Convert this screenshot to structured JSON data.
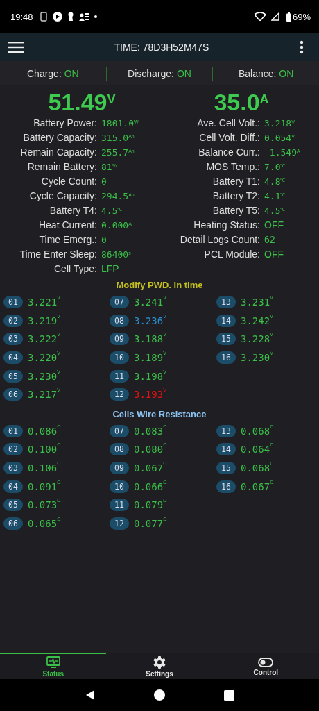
{
  "status_bar": {
    "time": "19:48",
    "battery": "69%"
  },
  "app_bar": {
    "title": "TIME: 78D3H52M47S"
  },
  "switches": [
    {
      "label": "Charge:",
      "value": "ON"
    },
    {
      "label": "Discharge:",
      "value": "ON"
    },
    {
      "label": "Balance:",
      "value": "ON"
    }
  ],
  "headline": [
    {
      "value": "51.49",
      "unit": "V"
    },
    {
      "value": "35.0",
      "unit": "A"
    }
  ],
  "stats_left": [
    {
      "label": "Battery Power:",
      "value": "1801.0",
      "unit": "W",
      "kind": "mono"
    },
    {
      "label": "Battery Capacity:",
      "value": "315.0",
      "unit": "Ah",
      "kind": "mono"
    },
    {
      "label": "Remain Capacity:",
      "value": "255.7",
      "unit": "Ah",
      "kind": "mono"
    },
    {
      "label": "Remain Battery:",
      "value": "81",
      "unit": "%",
      "kind": "mono"
    },
    {
      "label": "Cycle Count:",
      "value": "0",
      "kind": "mono"
    },
    {
      "label": "Cycle Capacity:",
      "value": "294.5",
      "unit": "Ah",
      "kind": "mono"
    },
    {
      "label": "Battery T4:",
      "value": "4.5",
      "unit": "℃",
      "kind": "mono"
    },
    {
      "label": "Heat Current:",
      "value": "0.000",
      "unit": "A",
      "kind": "mono"
    },
    {
      "label": "Time Emerg.:",
      "value": "0",
      "kind": "mono"
    },
    {
      "label": "Time Enter Sleep:",
      "value": "86400",
      "unit": "s",
      "kind": "mono"
    },
    {
      "label": "Cell Type:",
      "value": "LFP",
      "kind": "text"
    }
  ],
  "stats_right": [
    {
      "label": "Ave. Cell Volt.:",
      "value": "3.218",
      "unit": "V",
      "kind": "mono"
    },
    {
      "label": "Cell Volt. Diff.:",
      "value": "0.054",
      "unit": "V",
      "kind": "mono"
    },
    {
      "label": "Balance Curr.:",
      "value": "-1.549",
      "unit": "A",
      "kind": "mono"
    },
    {
      "label": "MOS Temp.:",
      "value": "7.0",
      "unit": "℃",
      "kind": "mono"
    },
    {
      "label": "Battery T1:",
      "value": "4.8",
      "unit": "℃",
      "kind": "mono"
    },
    {
      "label": "Battery T2:",
      "value": "4.1",
      "unit": "℃",
      "kind": "mono"
    },
    {
      "label": "Battery T5:",
      "value": "4.5",
      "unit": "℃",
      "kind": "mono"
    },
    {
      "label": "Heating Status:",
      "value": "OFF",
      "kind": "text"
    },
    {
      "label": "Detail Logs Count:",
      "value": "62",
      "kind": "text"
    },
    {
      "label": "PCL Module:",
      "value": "OFF",
      "kind": "text"
    }
  ],
  "cell_voltages": {
    "title": "Modify PWD. in time",
    "cells": [
      {
        "index": "01",
        "value": "3.221",
        "unit": "V",
        "color": "#3bbf48"
      },
      {
        "index": "02",
        "value": "3.219",
        "unit": "V",
        "color": "#3bbf48"
      },
      {
        "index": "03",
        "value": "3.222",
        "unit": "V",
        "color": "#3bbf48"
      },
      {
        "index": "04",
        "value": "3.220",
        "unit": "V",
        "color": "#3bbf48"
      },
      {
        "index": "05",
        "value": "3.230",
        "unit": "V",
        "color": "#3bbf48"
      },
      {
        "index": "06",
        "value": "3.217",
        "unit": "V",
        "color": "#3bbf48"
      },
      {
        "index": "07",
        "value": "3.241",
        "unit": "V",
        "color": "#3bbf48"
      },
      {
        "index": "08",
        "value": "3.236",
        "unit": "V",
        "color": "#2a8fd0"
      },
      {
        "index": "09",
        "value": "3.188",
        "unit": "V",
        "color": "#3bbf48"
      },
      {
        "index": "10",
        "value": "3.189",
        "unit": "V",
        "color": "#3bbf48"
      },
      {
        "index": "11",
        "value": "3.198",
        "unit": "V",
        "color": "#3bbf48"
      },
      {
        "index": "12",
        "value": "3.193",
        "unit": "V",
        "color": "#e81010"
      },
      {
        "index": "13",
        "value": "3.231",
        "unit": "V",
        "color": "#3bbf48"
      },
      {
        "index": "14",
        "value": "3.242",
        "unit": "V",
        "color": "#3bbf48"
      },
      {
        "index": "15",
        "value": "3.228",
        "unit": "V",
        "color": "#3bbf48"
      },
      {
        "index": "16",
        "value": "3.230",
        "unit": "V",
        "color": "#3bbf48"
      }
    ]
  },
  "wire_resistance": {
    "title": "Cells Wire Resistance",
    "cells": [
      {
        "index": "01",
        "value": "0.086",
        "unit": "Ω"
      },
      {
        "index": "02",
        "value": "0.100",
        "unit": "Ω"
      },
      {
        "index": "03",
        "value": "0.106",
        "unit": "Ω"
      },
      {
        "index": "04",
        "value": "0.091",
        "unit": "Ω"
      },
      {
        "index": "05",
        "value": "0.073",
        "unit": "Ω"
      },
      {
        "index": "06",
        "value": "0.065",
        "unit": "Ω"
      },
      {
        "index": "07",
        "value": "0.083",
        "unit": "Ω"
      },
      {
        "index": "08",
        "value": "0.080",
        "unit": "Ω"
      },
      {
        "index": "09",
        "value": "0.067",
        "unit": "Ω"
      },
      {
        "index": "10",
        "value": "0.066",
        "unit": "Ω"
      },
      {
        "index": "11",
        "value": "0.079",
        "unit": "Ω"
      },
      {
        "index": "12",
        "value": "0.077",
        "unit": "Ω"
      },
      {
        "index": "13",
        "value": "0.068",
        "unit": "Ω"
      },
      {
        "index": "14",
        "value": "0.064",
        "unit": "Ω"
      },
      {
        "index": "15",
        "value": "0.068",
        "unit": "Ω"
      },
      {
        "index": "16",
        "value": "0.067",
        "unit": "Ω"
      }
    ]
  },
  "bottom_nav": [
    {
      "label": "Status",
      "kind": "status",
      "selected": true
    },
    {
      "label": "Settings",
      "kind": "settings",
      "selected": false
    },
    {
      "label": "Control",
      "kind": "control",
      "selected": false
    }
  ]
}
